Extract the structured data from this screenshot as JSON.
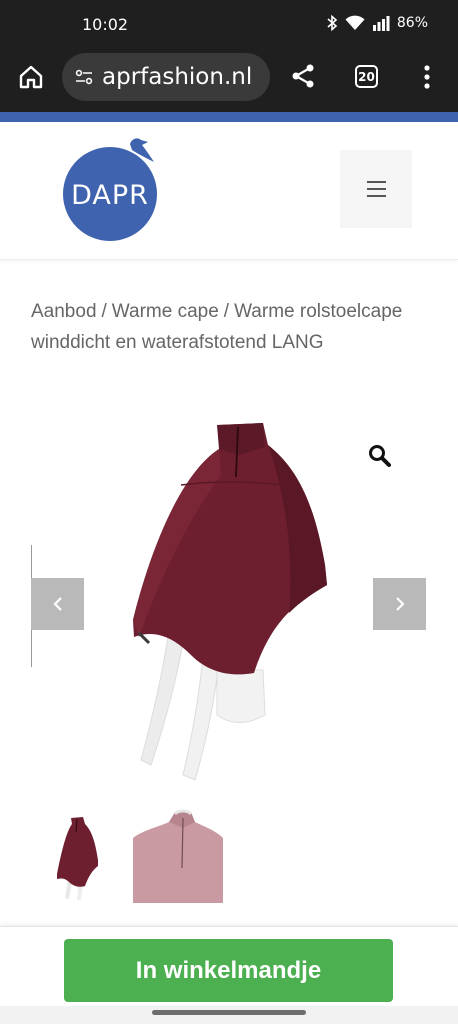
{
  "status_bar": {
    "time": "10:02",
    "battery": "86%",
    "icons": [
      "bluetooth-icon",
      "wifi-icon",
      "signal-icon"
    ]
  },
  "browser": {
    "url": "aprfashion.nl",
    "tab_count": "20",
    "icons": [
      "home-icon",
      "site-info-icon",
      "share-icon",
      "more-icon"
    ]
  },
  "header": {
    "logo_text": "DAPR",
    "colors": {
      "brand_blue": "#3f63ae",
      "accent_strip": "#3f63ae"
    }
  },
  "breadcrumb": {
    "items": [
      "Aanbod",
      "Warme cape",
      "Warme rolstoelcape winddicht en waterafstotend LANG"
    ],
    "separator": "/"
  },
  "gallery": {
    "icons": [
      "zoom-icon",
      "chevron-left-icon",
      "chevron-right-icon"
    ],
    "product_color": "#6e1f2f",
    "thumbnail_count": 2
  },
  "cart": {
    "button_label": "In winkelmandje",
    "color": "#4caf50"
  }
}
